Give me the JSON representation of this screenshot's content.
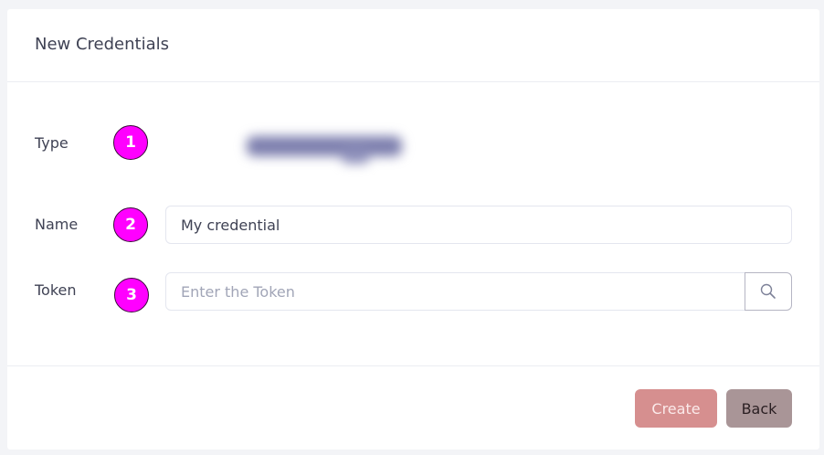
{
  "form": {
    "title": "New Credentials",
    "fields": [
      {
        "label": "Type",
        "badge": "1"
      },
      {
        "label": "Name",
        "badge": "2",
        "value": "My credential"
      },
      {
        "label": "Token",
        "badge": "3",
        "placeholder": "Enter the Token"
      }
    ],
    "search_icon": "search-icon"
  },
  "footer": {
    "create_label": "Create",
    "back_label": "Back"
  },
  "colors": {
    "badge": "#ff00ff",
    "create_button": "#d68f8f",
    "back_button": "#a99597"
  }
}
